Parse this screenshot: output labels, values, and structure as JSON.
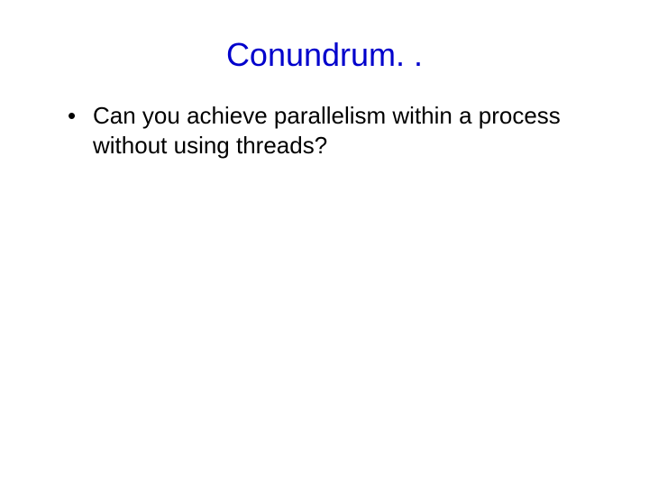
{
  "slide": {
    "title": "Conundrum. .",
    "bullets": [
      "Can you achieve parallelism within a process without using threads?"
    ]
  }
}
